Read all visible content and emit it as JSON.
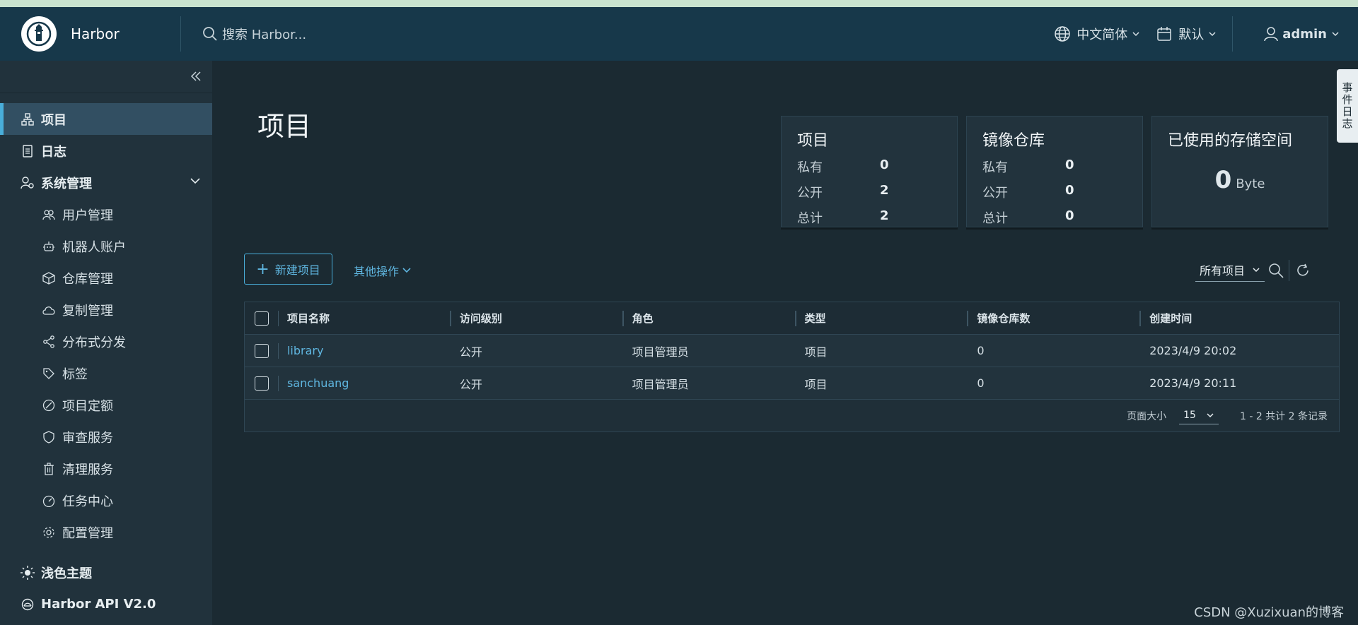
{
  "app": {
    "name": "Harbor"
  },
  "header": {
    "search_placeholder": "搜索 Harbor...",
    "language": "中文简体",
    "date_format": "默认",
    "user": "admin"
  },
  "sidebar": {
    "items": [
      {
        "label": "项目",
        "icon": "projects-icon",
        "active": true
      },
      {
        "label": "日志",
        "icon": "logs-icon"
      },
      {
        "label": "系统管理",
        "icon": "admin-icon",
        "expanded": true
      },
      {
        "label": "用户管理",
        "icon": "users-icon"
      },
      {
        "label": "机器人账户",
        "icon": "robot-icon"
      },
      {
        "label": "仓库管理",
        "icon": "registry-icon"
      },
      {
        "label": "复制管理",
        "icon": "replication-icon"
      },
      {
        "label": "分布式分发",
        "icon": "distribution-icon"
      },
      {
        "label": "标签",
        "icon": "tag-icon"
      },
      {
        "label": "项目定额",
        "icon": "quota-icon"
      },
      {
        "label": "审查服务",
        "icon": "shield-icon"
      },
      {
        "label": "清理服务",
        "icon": "trash-icon"
      },
      {
        "label": "任务中心",
        "icon": "dashboard-icon"
      },
      {
        "label": "配置管理",
        "icon": "gear-icon"
      }
    ],
    "theme": "浅色主题",
    "api": "Harbor API V2.0"
  },
  "main": {
    "title": "项目",
    "cards": {
      "projects": {
        "title": "项目",
        "private_label": "私有",
        "private": "0",
        "public_label": "公开",
        "public": "2",
        "total_label": "总计",
        "total": "2"
      },
      "repos": {
        "title": "镜像仓库",
        "private_label": "私有",
        "private": "0",
        "public_label": "公开",
        "public": "0",
        "total_label": "总计",
        "total": "0"
      },
      "storage": {
        "title": "已使用的存储空间",
        "value": "0",
        "unit": "Byte"
      }
    },
    "new_project": "新建项目",
    "other_actions": "其他操作",
    "filter": "所有项目",
    "table": {
      "headers": [
        "项目名称",
        "访问级别",
        "角色",
        "类型",
        "镜像仓库数",
        "创建时间"
      ],
      "rows": [
        [
          "library",
          "公开",
          "项目管理员",
          "项目",
          "0",
          "2023/4/9 20:02"
        ],
        [
          "sanchuang",
          "公开",
          "项目管理员",
          "项目",
          "0",
          "2023/4/9 20:11"
        ]
      ],
      "page_size_label": "页面大小",
      "page_size": "15",
      "summary": "1 - 2 共计 2 条记录"
    }
  },
  "side_tab": "事件日志",
  "watermark": "CSDN @Xuzixuan的博客"
}
